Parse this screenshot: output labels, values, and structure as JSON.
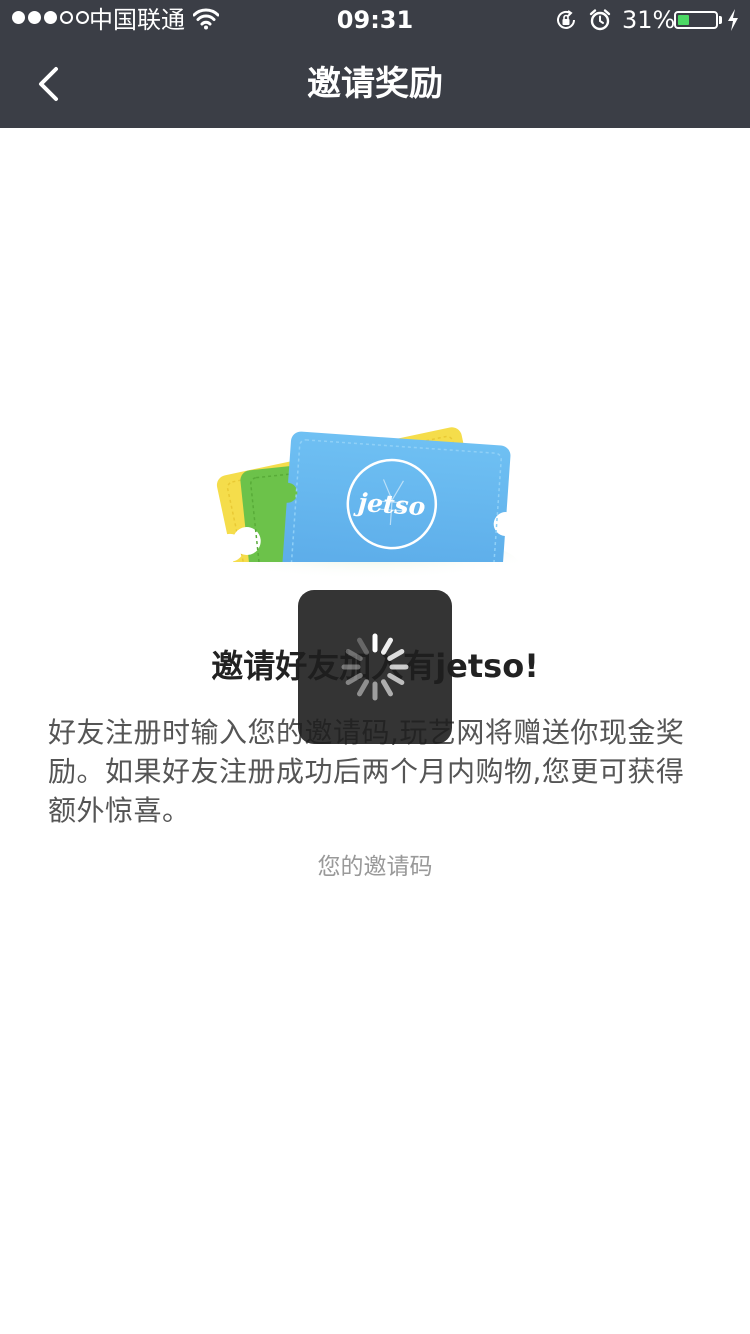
{
  "status_bar": {
    "carrier": "中国联通",
    "time": "09:31",
    "battery_percent": "31%",
    "battery_level": 0.31,
    "signal_bars": 3,
    "signal_total": 5,
    "icons": [
      "wifi-icon",
      "rotation-lock-icon",
      "alarm-icon",
      "battery-icon",
      "charging-bolt-icon"
    ]
  },
  "nav": {
    "back_icon": "chevron-left-icon",
    "title": "邀请奖励"
  },
  "illustration": {
    "ticket_stamp_text": "jetso",
    "colors": {
      "yellow_ticket": "#f5dd4b",
      "green_ticket": "#6cc24a",
      "blue_ticket": "#5fb3ee"
    }
  },
  "content": {
    "headline": "邀请好友加入有jetso!",
    "description": "好友注册时输入您的邀请码,玩艺网将赠送你现金奖励。如果好友注册成功后两个月内购物,您更可获得额外惊喜。",
    "code_label": "您的邀请码"
  },
  "loading": {
    "icon": "spinner-icon"
  },
  "colors": {
    "header_bg": "#3b3e46",
    "battery_fill": "#4cd964"
  }
}
